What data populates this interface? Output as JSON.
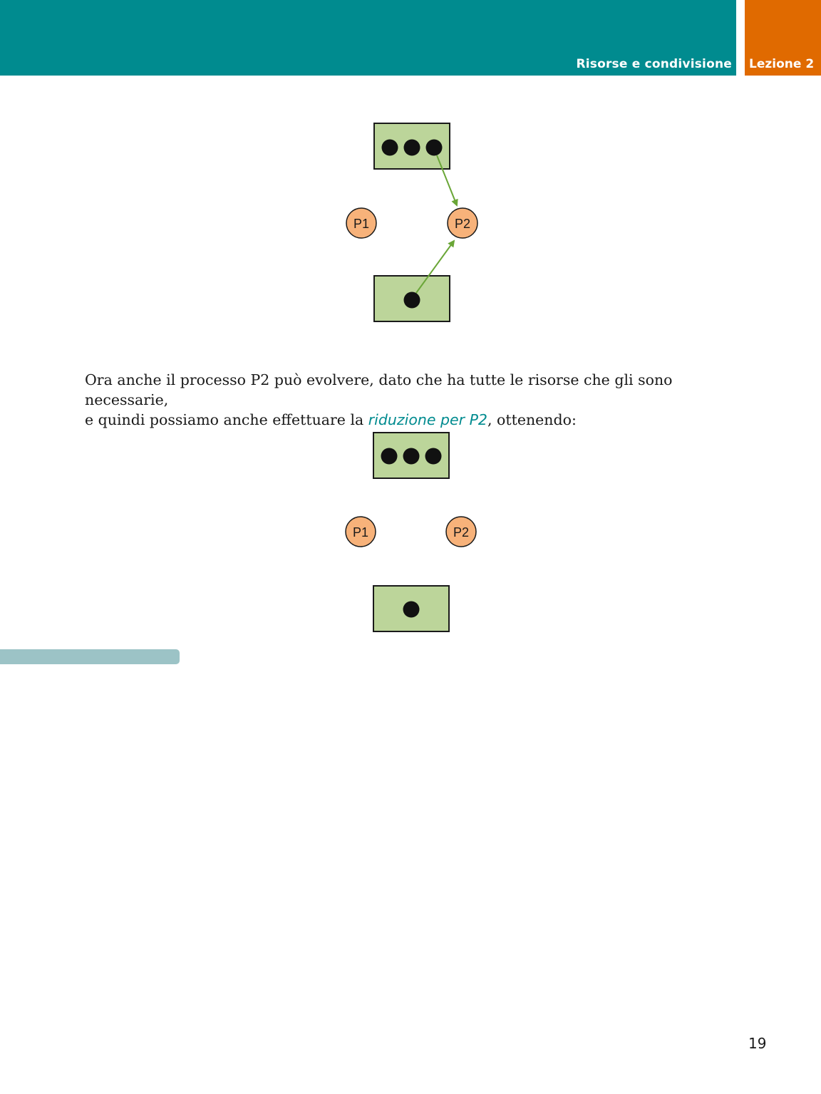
{
  "header": {
    "section_title": "Risorse e condivisione",
    "lesson_label": "Lezione 2",
    "colors": {
      "band": "#008b8f",
      "lesson": "#e06a00"
    }
  },
  "diagram_1": {
    "processes": [
      "P1",
      "P2"
    ],
    "top_resource_instances": 3,
    "bottom_resource_instances": 1,
    "edges": [
      {
        "from": "top-resource-instance-3",
        "to": "P2"
      },
      {
        "from": "bottom-resource-instance-1",
        "to": "P2"
      }
    ]
  },
  "body": {
    "line1": "Ora anche il processo P2 può evolvere, dato che ha tutte le risorse che gli sono necessarie,",
    "line2_before": "e quindi possiamo anche effettuare la ",
    "term": "riduzione per P2",
    "line2_after": ", ottenendo:"
  },
  "diagram_2": {
    "processes": [
      "P1",
      "P2"
    ],
    "top_resource_instances": 3,
    "bottom_resource_instances": 1,
    "edges": []
  },
  "page_number": "19",
  "colors": {
    "resource_fill": "#bcd59a",
    "process_fill": "#f7b27a",
    "edge": "#6aa637"
  }
}
